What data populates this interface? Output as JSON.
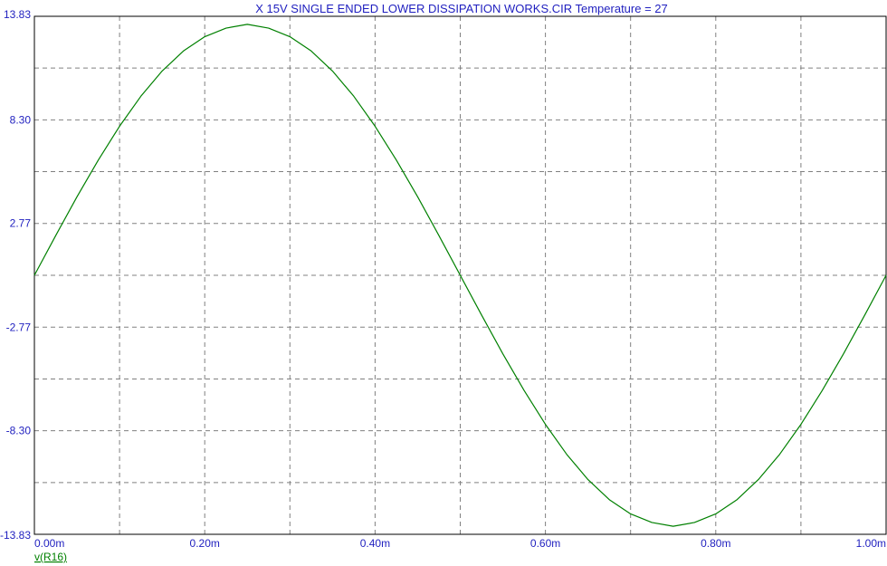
{
  "colors": {
    "text": "#1f1fbf",
    "axis": "#000000",
    "grid": "#808080",
    "trace": "#008000",
    "background": "#ffffff"
  },
  "chart_data": {
    "type": "line",
    "title": "X 15V SINGLE ENDED LOWER DISSIPATION WORKS.CIR Temperature = 27",
    "xlabel": "",
    "ylabel": "",
    "xlim": [
      0,
      1.0
    ],
    "ylim": [
      -13.83,
      13.83
    ],
    "x_unit": "ms",
    "grid": true,
    "x_gridlines": [
      0.1,
      0.2,
      0.3,
      0.4,
      0.5,
      0.6,
      0.7,
      0.8,
      0.9
    ],
    "y_gridlines": [
      -11.065,
      -8.3,
      -5.535,
      -2.77,
      0,
      2.77,
      5.535,
      8.3,
      11.065
    ],
    "x_tick_values": [
      0,
      0.2,
      0.4,
      0.6,
      0.8,
      1.0
    ],
    "x_tick_labels": [
      "0.00m",
      "0.20m",
      "0.40m",
      "0.60m",
      "0.80m",
      "1.00m"
    ],
    "y_tick_values": [
      13.83,
      8.3,
      2.77,
      -2.77,
      -8.3,
      -13.83
    ],
    "y_tick_labels": [
      "13.83",
      "8.30",
      "2.77",
      "-2.77",
      "-8.30",
      "-13.83"
    ],
    "legend_placement": "bottom-left",
    "series": [
      {
        "name": "v(R16)",
        "x": [
          0.0,
          0.025,
          0.05,
          0.075,
          0.1,
          0.125,
          0.15,
          0.175,
          0.2,
          0.225,
          0.25,
          0.275,
          0.3,
          0.325,
          0.35,
          0.375,
          0.4,
          0.425,
          0.45,
          0.475,
          0.5,
          0.525,
          0.55,
          0.575,
          0.6,
          0.625,
          0.65,
          0.675,
          0.7,
          0.725,
          0.75,
          0.775,
          0.8,
          0.825,
          0.85,
          0.875,
          0.9,
          0.925,
          0.95,
          0.975,
          1.0
        ],
        "y": [
          0.0,
          2.12,
          4.19,
          6.15,
          7.96,
          9.56,
          10.91,
          11.98,
          12.74,
          13.2,
          13.4,
          13.2,
          12.74,
          11.98,
          10.91,
          9.56,
          7.96,
          6.15,
          4.19,
          2.12,
          0.0,
          -2.12,
          -4.19,
          -6.15,
          -7.96,
          -9.56,
          -10.91,
          -11.98,
          -12.74,
          -13.2,
          -13.4,
          -13.2,
          -12.74,
          -11.98,
          -10.91,
          -9.56,
          -7.96,
          -6.15,
          -4.19,
          -2.12,
          0.0
        ]
      }
    ]
  }
}
